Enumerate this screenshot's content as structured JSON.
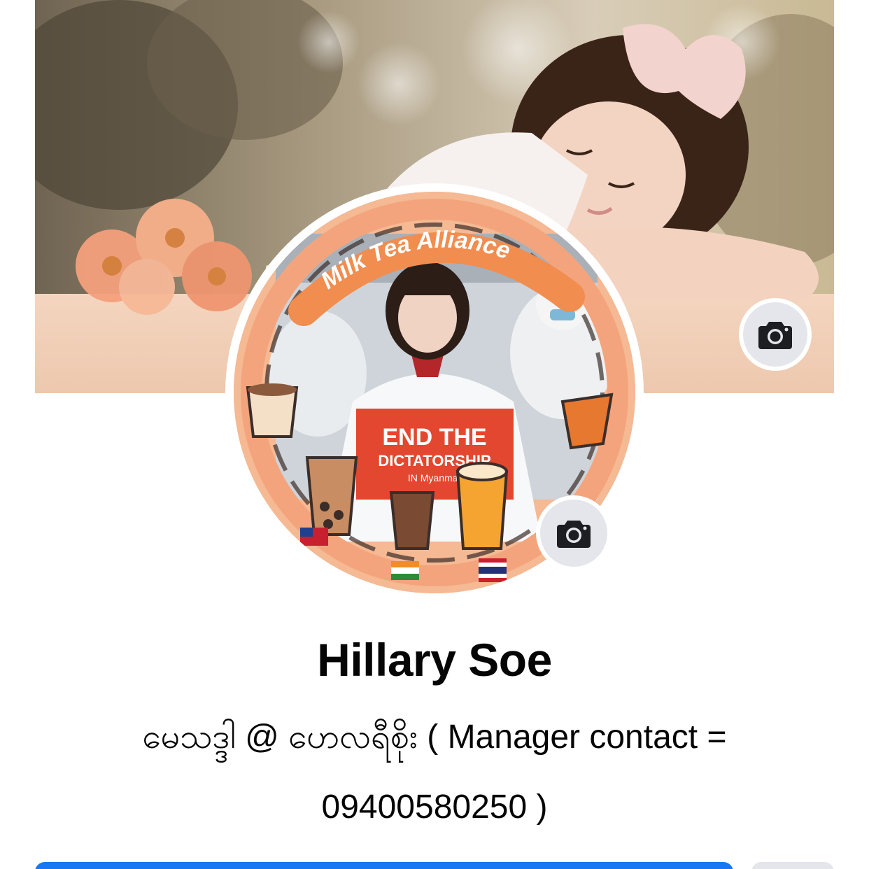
{
  "profile": {
    "name": "Hillary Soe",
    "bio": "မေသဒ္ဒါ @ ဟေလရီစိုး ( Manager contact = 09400580250 )"
  },
  "cover_photo": {
    "icon": "camera-icon"
  },
  "profile_picture": {
    "icon": "camera-icon",
    "banner_text": "Milk Tea Alliance",
    "sign_line1": "END THE",
    "sign_line2": "DICTATORSHIP",
    "sign_line3": "IN Myanmar"
  },
  "colors": {
    "primary_button": "#1877f2",
    "secondary_button": "#e4e6eb",
    "text": "#050505"
  }
}
